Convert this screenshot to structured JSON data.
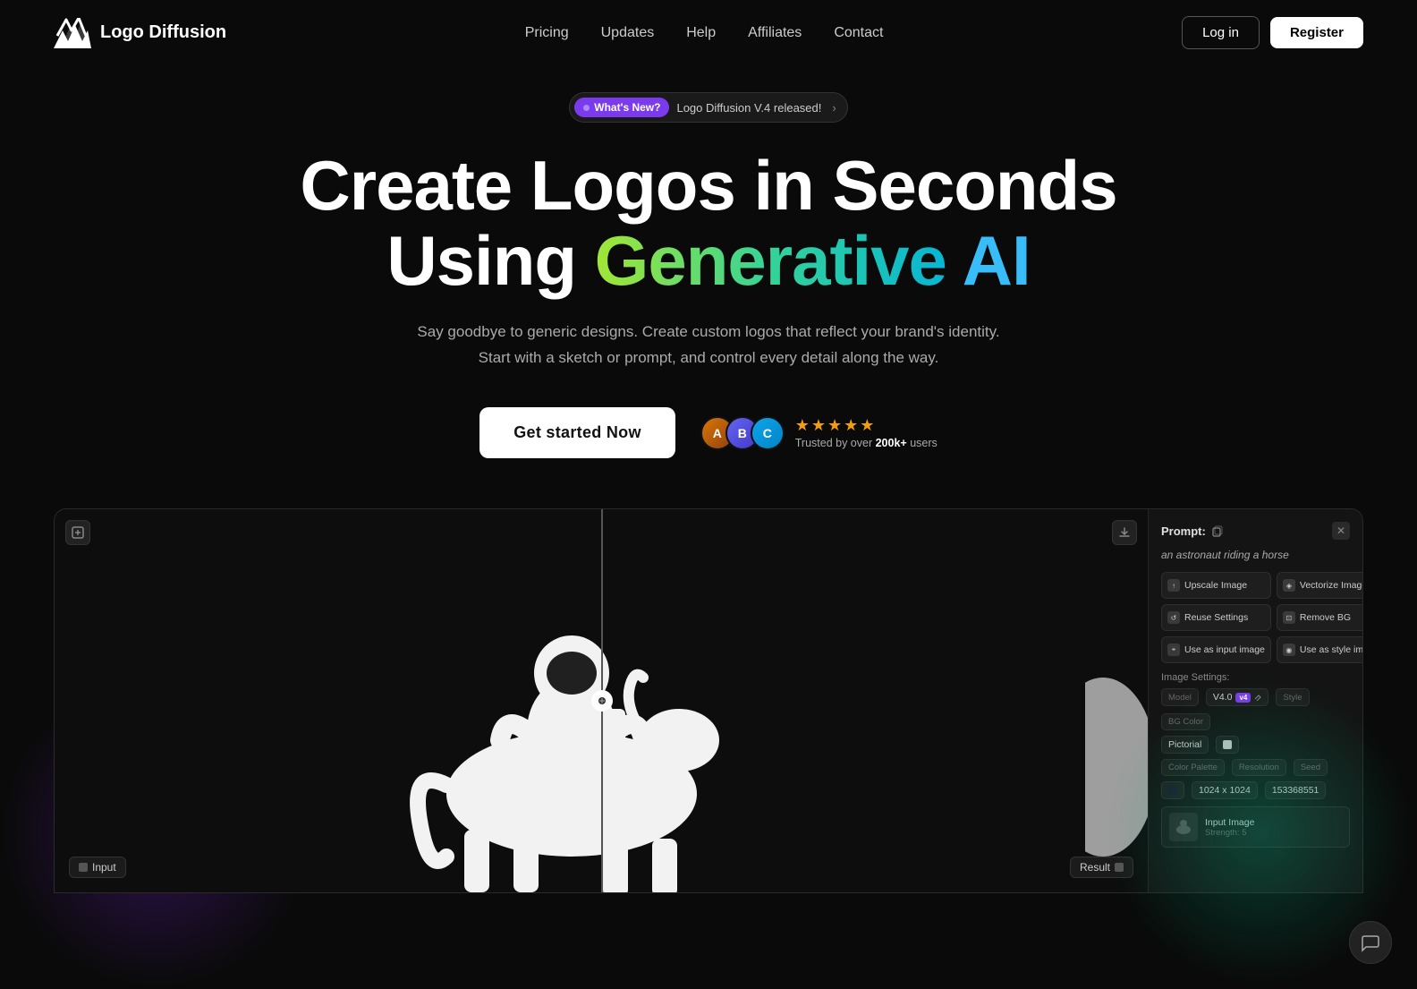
{
  "brand": {
    "name": "Logo Diffusion",
    "logo_alt": "Logo Diffusion"
  },
  "nav": {
    "links": [
      {
        "label": "Pricing",
        "href": "#"
      },
      {
        "label": "Updates",
        "href": "#"
      },
      {
        "label": "Help",
        "href": "#"
      },
      {
        "label": "Affiliates",
        "href": "#"
      },
      {
        "label": "Contact",
        "href": "#"
      }
    ],
    "login": "Log in",
    "register": "Register"
  },
  "announcement": {
    "badge": "What's New?",
    "text": "Logo Diffusion V.4 released!",
    "arrow": "›"
  },
  "hero": {
    "heading_line1": "Create Logos in Seconds",
    "heading_line2_pre": "Using ",
    "heading_generative": "Generative",
    "heading_ai": "AI",
    "subtitle_line1": "Say goodbye to generic designs. Create custom logos that reflect your brand's identity.",
    "subtitle_line2": "Start with a sketch or prompt, and control every detail along the way.",
    "cta": "Get started  Now",
    "stars": "★★★★★",
    "trust": "Trusted by over ",
    "trust_count": "200k+",
    "trust_suffix": " users"
  },
  "panel": {
    "prompt_label": "Prompt:",
    "prompt_text": "an astronaut riding a horse",
    "buttons": [
      {
        "label": "Upscale Image",
        "icon": "↑"
      },
      {
        "label": "Vectorize Image",
        "icon": "◈"
      },
      {
        "label": "Reuse Settings",
        "icon": "↺"
      },
      {
        "label": "Remove BG",
        "icon": "⊡"
      },
      {
        "label": "Use as input image",
        "icon": "⌖"
      },
      {
        "label": "Use as style image",
        "icon": "◉"
      }
    ],
    "image_settings_label": "Image Settings:",
    "settings": {
      "model_label": "Model",
      "model_value": "V4.0",
      "model_badge": "v4",
      "style_label": "Style",
      "style_value": "Pictorial",
      "bg_color_label": "BG Color",
      "color_palette_label": "Color Palette",
      "resolution_label": "Resolution",
      "resolution_value": "1024 x 1024",
      "seed_label": "Seed",
      "seed_value": "153368551"
    },
    "input_image_title": "Input Image",
    "input_image_strength": "Strength: 5"
  },
  "canvas": {
    "label_input": "Input",
    "label_result": "Result"
  },
  "colors": {
    "accent_purple": "#7c3aed",
    "accent_green": "#a3e635",
    "accent_cyan": "#38bdf8",
    "accent_teal": "#34d399",
    "star_color": "#f59e0b"
  }
}
